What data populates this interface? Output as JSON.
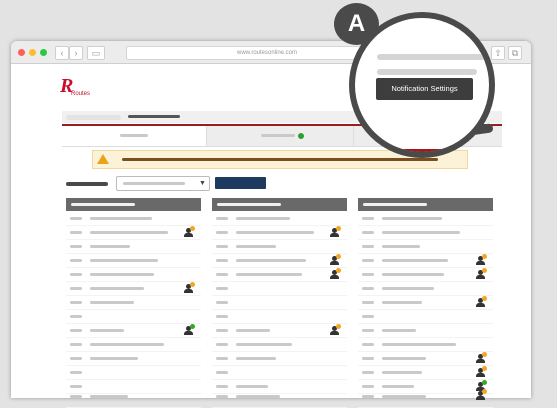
{
  "browser": {
    "url": "www.routesonline.com"
  },
  "logo": {
    "text": "Routes"
  },
  "magnifier": {
    "button_label": "Notification Settings"
  },
  "callout": {
    "label": "A"
  },
  "colors": {
    "brand_red": "#9b1c20",
    "status_online": "#3aa52a",
    "status_away": "#f3a623",
    "primary_button": "#1e3a5f"
  }
}
